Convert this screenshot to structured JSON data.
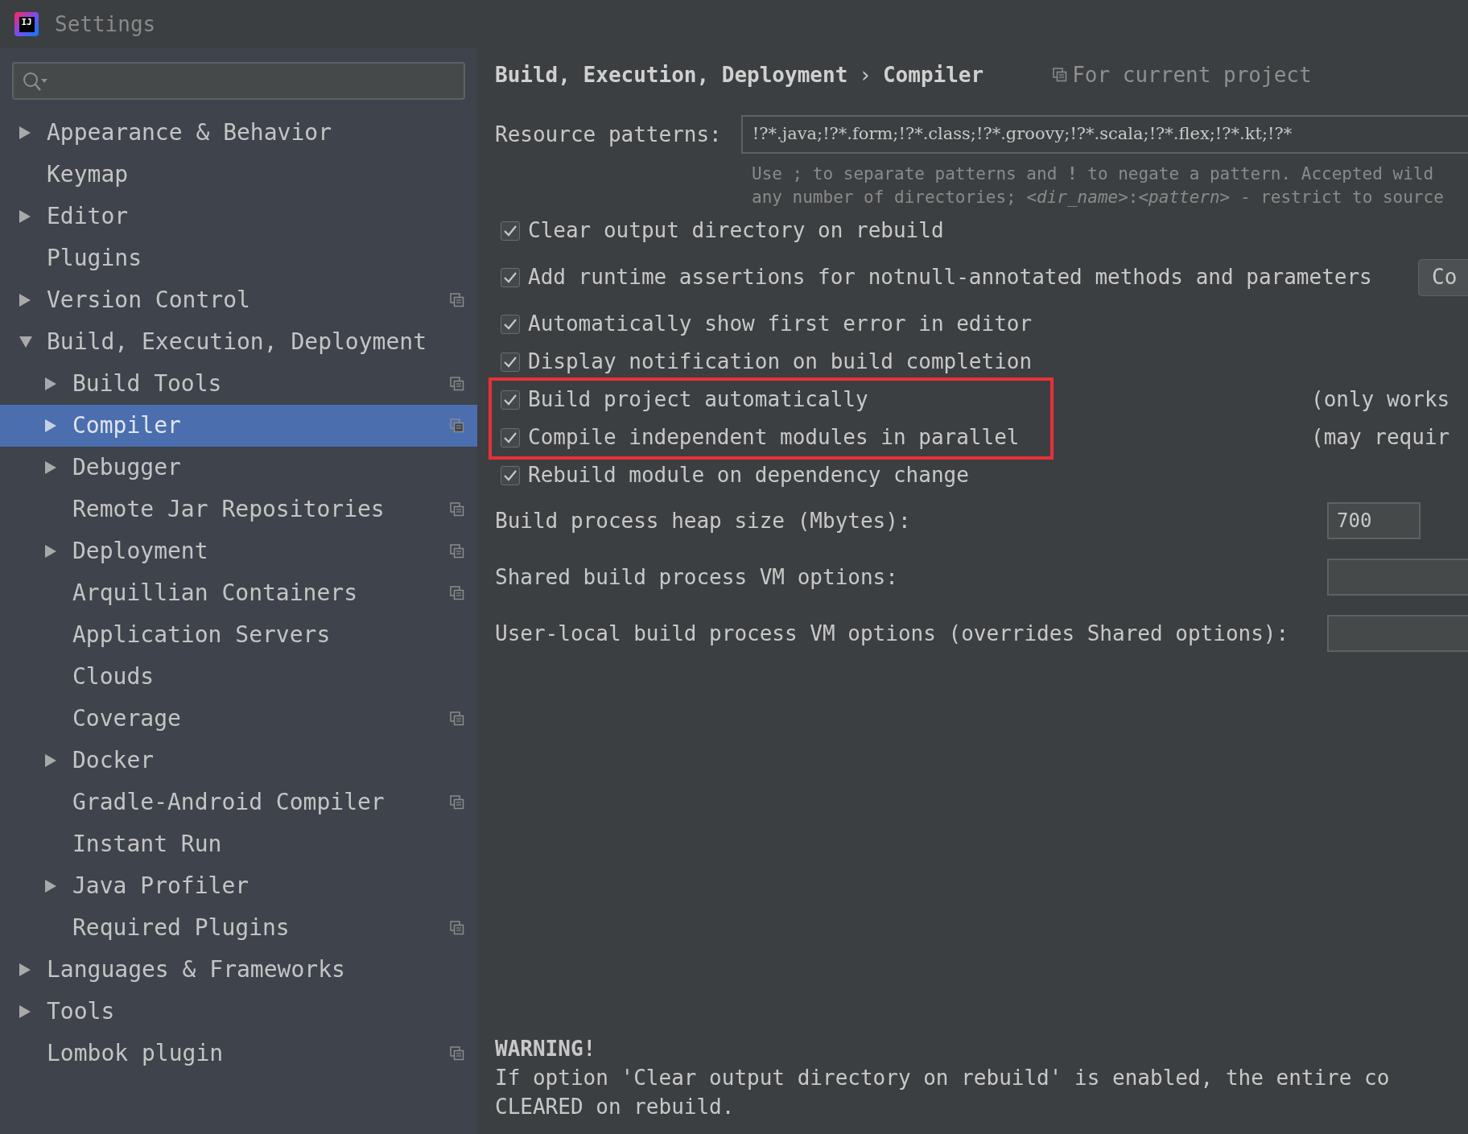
{
  "window": {
    "logo_text": "IJ",
    "title": "Settings"
  },
  "sidebar": {
    "items": [
      {
        "label": "Appearance & Behavior",
        "expanded": false,
        "selected": false,
        "project_level": false
      },
      {
        "label": "Keymap",
        "selected": false,
        "project_level": false
      },
      {
        "label": "Editor",
        "expanded": false,
        "selected": false,
        "project_level": false
      },
      {
        "label": "Plugins",
        "selected": false,
        "project_level": false
      },
      {
        "label": "Version Control",
        "expanded": false,
        "selected": false,
        "project_level": true
      },
      {
        "label": "Build, Execution, Deployment",
        "expanded": true,
        "selected": false,
        "project_level": false,
        "children": [
          {
            "label": "Build Tools",
            "expanded": false,
            "selected": false,
            "project_level": true
          },
          {
            "label": "Compiler",
            "expanded": false,
            "selected": true,
            "project_level": true
          },
          {
            "label": "Debugger",
            "expanded": false,
            "selected": false,
            "project_level": false
          },
          {
            "label": "Remote Jar Repositories",
            "selected": false,
            "project_level": true
          },
          {
            "label": "Deployment",
            "expanded": false,
            "selected": false,
            "project_level": true
          },
          {
            "label": "Arquillian Containers",
            "selected": false,
            "project_level": true
          },
          {
            "label": "Application Servers",
            "selected": false,
            "project_level": false
          },
          {
            "label": "Clouds",
            "selected": false,
            "project_level": false
          },
          {
            "label": "Coverage",
            "selected": false,
            "project_level": true
          },
          {
            "label": "Docker",
            "expanded": false,
            "selected": false,
            "project_level": false
          },
          {
            "label": "Gradle-Android Compiler",
            "selected": false,
            "project_level": true
          },
          {
            "label": "Instant Run",
            "selected": false,
            "project_level": false
          },
          {
            "label": "Java Profiler",
            "expanded": false,
            "selected": false,
            "project_level": false
          },
          {
            "label": "Required Plugins",
            "selected": false,
            "project_level": true
          }
        ]
      },
      {
        "label": "Languages & Frameworks",
        "expanded": false,
        "selected": false,
        "project_level": false
      },
      {
        "label": "Tools",
        "expanded": false,
        "selected": false,
        "project_level": false
      },
      {
        "label": "Lombok plugin",
        "selected": false,
        "project_level": true
      }
    ]
  },
  "content": {
    "breadcrumb": [
      "Build, Execution, Deployment",
      "Compiler"
    ],
    "breadcrumb_separator": "›",
    "scope_note": "For current project",
    "resource_patterns": {
      "label": "Resource patterns:",
      "value": "!?*.java;!?*.form;!?*.class;!?*.groovy;!?*.scala;!?*.flex;!?*.kt;!?*"
    },
    "hint_lines": [
      "Use ; to separate patterns and **!** to negate a pattern. Accepted wild",
      "any number of directories; *<dir_name>*:*<pattern>* - restrict to source"
    ],
    "options": [
      {
        "label": "Clear output directory on rebuild",
        "checked": true,
        "highlighted": false
      },
      {
        "label": "Add runtime assertions for notnull-annotated methods and parameters",
        "checked": true,
        "highlighted": false,
        "button": "Co"
      },
      {
        "label": "Automatically show first error in editor",
        "checked": true,
        "highlighted": false
      },
      {
        "label": "Display notification on build completion",
        "checked": true,
        "highlighted": false
      },
      {
        "label": "Build project automatically",
        "checked": true,
        "highlighted": true,
        "note": "(only works"
      },
      {
        "label": "Compile independent modules in parallel",
        "checked": true,
        "highlighted": true,
        "note": "(may requir"
      },
      {
        "label": "Rebuild module on dependency change",
        "checked": true,
        "highlighted": false
      }
    ],
    "fields": [
      {
        "label": "Build process heap size (Mbytes):",
        "value": "700",
        "kind": "short"
      },
      {
        "label": "Shared build process VM options:",
        "kind": "wide"
      },
      {
        "label": "User-local build process VM options (overrides Shared options):",
        "kind": "wide"
      }
    ],
    "warning": {
      "title": "WARNING!",
      "lines": [
        "If option 'Clear output directory on rebuild' is enabled, the entire co",
        "CLEARED on rebuild."
      ]
    }
  }
}
